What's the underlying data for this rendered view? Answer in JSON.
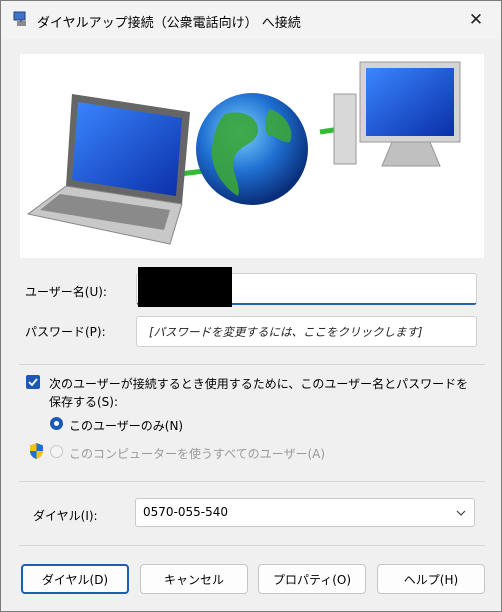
{
  "window": {
    "title": "ダイヤルアップ接続（公衆電話向け） へ接続",
    "close": "✕"
  },
  "labels": {
    "username": "ユーザー名(U):",
    "password": "パスワード(P):",
    "dial": "ダイヤル(I):"
  },
  "password_placeholder": "[パスワードを変更するには、ここをクリックします]",
  "save_checkbox": {
    "label_line1": "次のユーザーが接続するとき使用するために、このユーザー名とパスワードを",
    "label_line2": "保存する(S):",
    "checked": true
  },
  "radio_options": [
    {
      "label": "このユーザーのみ(N)",
      "selected": true,
      "enabled": true
    },
    {
      "label": "このコンピューターを使うすべてのユーザー(A)",
      "selected": false,
      "enabled": false
    }
  ],
  "dial_value": "0570-055-540",
  "buttons": {
    "dial": "ダイヤル(D)",
    "cancel": "キャンセル",
    "properties": "プロパティ(O)",
    "help": "ヘルプ(H)"
  },
  "colors": {
    "accent": "#1b5ab3",
    "background": "#f0f0f0"
  }
}
